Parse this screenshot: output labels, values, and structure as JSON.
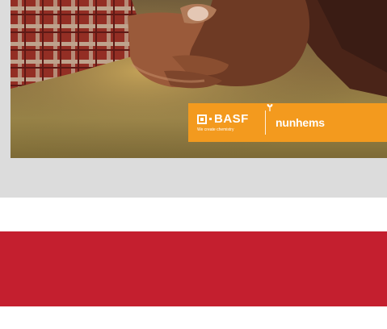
{
  "hero": {
    "logos": {
      "basf_name": "BASF",
      "basf_tagline": "We create chemistry",
      "partner_name": "nunhems"
    }
  },
  "colors": {
    "panel_gray": "#dcdcdc",
    "logo_orange": "#f39a1e",
    "banner_red": "#c41f2f"
  }
}
